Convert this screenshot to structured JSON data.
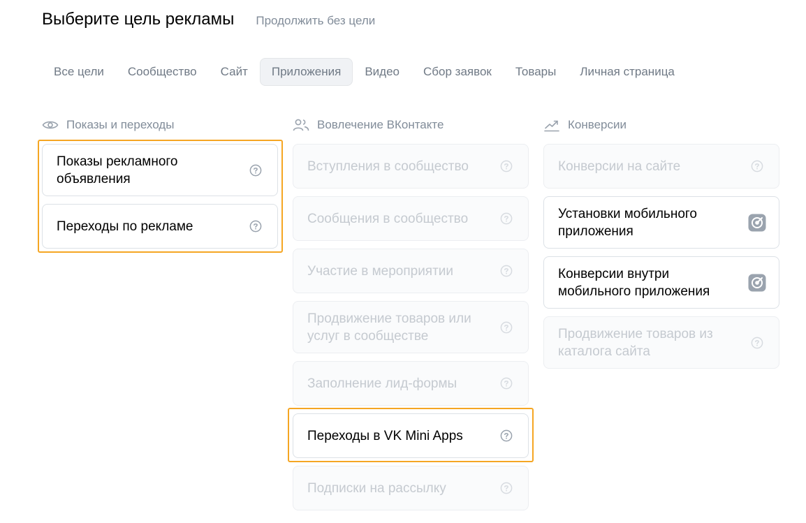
{
  "header": {
    "title": "Выберите цель рекламы",
    "skip_label": "Продолжить без цели"
  },
  "tabs": [
    {
      "label": "Все цели",
      "active": false
    },
    {
      "label": "Сообщество",
      "active": false
    },
    {
      "label": "Сайт",
      "active": false
    },
    {
      "label": "Приложения",
      "active": true
    },
    {
      "label": "Видео",
      "active": false
    },
    {
      "label": "Сбор заявок",
      "active": false
    },
    {
      "label": "Товары",
      "active": false
    },
    {
      "label": "Личная страница",
      "active": false
    }
  ],
  "columns": [
    {
      "title": "Показы и переходы",
      "icon": "eye-icon",
      "items": [
        {
          "label": "Показы рекламного объявления",
          "enabled": true,
          "icon": "help-icon"
        },
        {
          "label": "Переходы по рекламе",
          "enabled": true,
          "icon": "help-icon"
        }
      ]
    },
    {
      "title": "Вовлечение ВКонтакте",
      "icon": "users-icon",
      "items": [
        {
          "label": "Вступления в сообщество",
          "enabled": false,
          "icon": "help-icon"
        },
        {
          "label": "Сообщения в сообщество",
          "enabled": false,
          "icon": "help-icon"
        },
        {
          "label": "Участие в мероприятии",
          "enabled": false,
          "icon": "help-icon"
        },
        {
          "label": "Продвижение товаров или услуг в сообществе",
          "enabled": false,
          "icon": "help-icon"
        },
        {
          "label": "Заполнение лид-формы",
          "enabled": false,
          "icon": "help-icon"
        },
        {
          "label": "Переходы в VK Mini Apps",
          "enabled": true,
          "icon": "help-icon"
        },
        {
          "label": "Подписки на рассылку",
          "enabled": false,
          "icon": "help-icon"
        }
      ]
    },
    {
      "title": "Конверсии",
      "icon": "trend-up-icon",
      "items": [
        {
          "label": "Конверсии на сайте",
          "enabled": false,
          "icon": "help-icon"
        },
        {
          "label": "Установки мобильного приложения",
          "enabled": true,
          "icon": "tracker-icon"
        },
        {
          "label": "Конверсии внутри мобильного приложения",
          "enabled": true,
          "icon": "tracker-icon"
        },
        {
          "label": "Продвижение товаров из каталога сайта",
          "enabled": false,
          "icon": "help-icon"
        }
      ]
    }
  ],
  "colors": {
    "highlight": "#f5a623",
    "muted_text": "#818c99",
    "disabled_text": "#c5cad0",
    "border": "#dce1e6"
  }
}
